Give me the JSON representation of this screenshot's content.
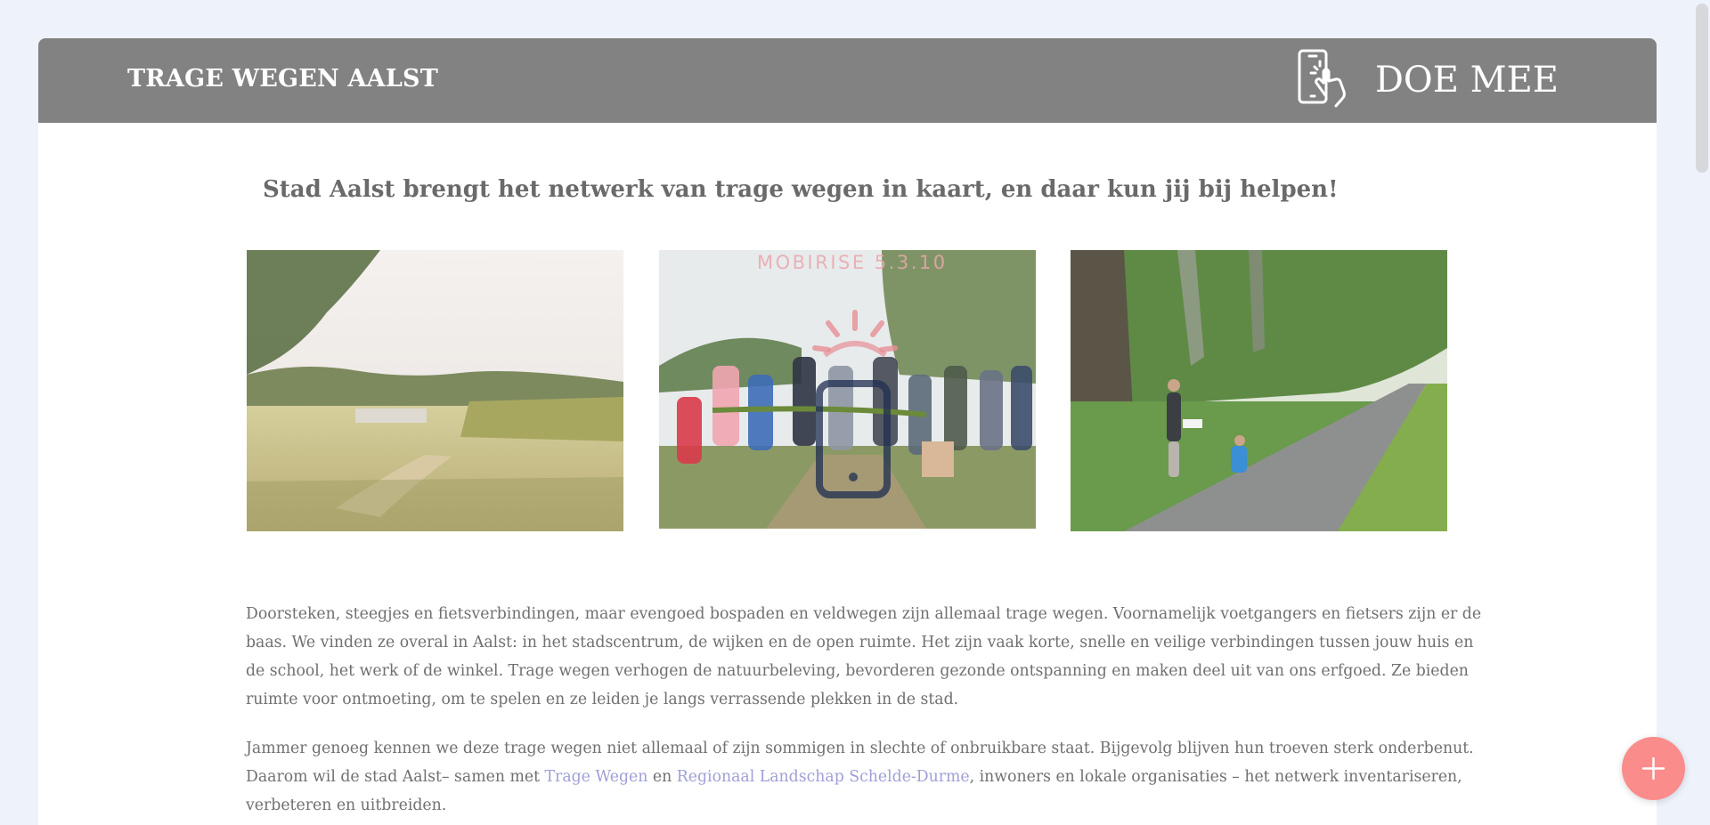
{
  "navbar": {
    "brand": "TRAGE WEGEN AALST",
    "cta_label": "DOE MEE",
    "cta_icon": "touch-phone-icon"
  },
  "main": {
    "headline": "Stad Aalst brengt het netwerk van trage wegen in kaart, en daar kun jij bij helpen!",
    "watermark": "MOBIRISE 5.3.10",
    "photos": [
      {
        "name": "field-path-photo"
      },
      {
        "name": "ribbon-cutting-photo"
      },
      {
        "name": "bike-path-photo"
      }
    ],
    "paragraph_1": "Doorsteken, steegjes en fietsverbindingen, maar evengoed bospaden en veldwegen zijn allemaal trage wegen. Voornamelijk voetgangers en fietsers zijn er de baas. We vinden ze overal in Aalst: in het stadscentrum, de wijken en de open ruimte. Het zijn vaak korte, snelle en veilige verbindingen tussen jouw huis en de school, het werk of de winkel. Trage wegen verhogen de natuurbeleving, bevorderen gezonde ontspanning en maken deel uit van ons erfgoed. Ze bieden ruimte voor ontmoeting, om te spelen en ze leiden je langs verrassende plekken in de stad.",
    "paragraph_2": {
      "before": "Jammer genoeg kennen we deze trage wegen niet allemaal of zijn sommigen in slechte of onbruikbare staat. Bijgevolg blijven hun troeven sterk onderbenut. Daarom wil de stad Aalst– samen met ",
      "link_1": "Trage Wegen",
      "between": " en ",
      "link_2": "Regionaal Landschap Schelde-Durme",
      "after": ", inwoners en lokale organisaties – het netwerk inventariseren, verbeteren en uitbreiden."
    }
  },
  "fab": {
    "icon": "plus-icon"
  },
  "colors": {
    "navbar": "#828282",
    "page_bg": "#eef2fb",
    "link": "#9f9fd8",
    "fab": "#fb8c8c"
  }
}
